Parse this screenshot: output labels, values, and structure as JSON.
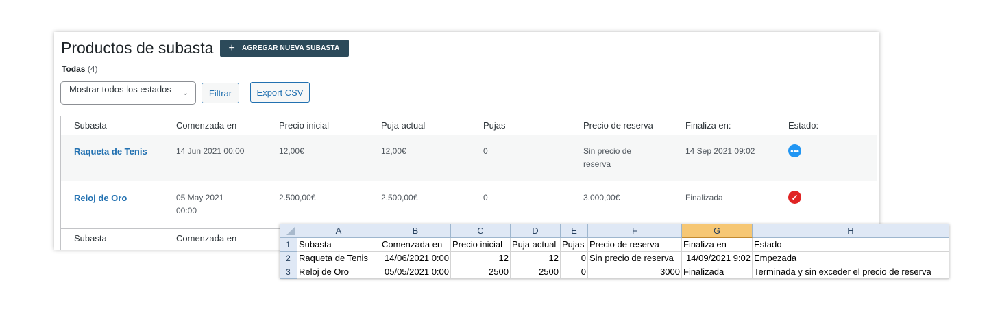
{
  "page": {
    "title": "Productos de subasta",
    "add_button": "AGREGAR NUEVA SUBASTA",
    "filter_label": "Todas",
    "filter_count": "(4)",
    "status_select_value": "Mostrar todos los estados",
    "filter_button": "Filtrar",
    "export_button": "Export CSV"
  },
  "table": {
    "columns": [
      "Subasta",
      "Comenzada en",
      "Precio inicial",
      "Puja actual",
      "Pujas",
      "Precio de reserva",
      "Finaliza en:",
      "Estado:"
    ],
    "rows": [
      {
        "name": "Raqueta de Tenis",
        "started": "14 Jun 2021 00:00",
        "start_price": "12,00€",
        "current_bid": "12,00€",
        "bids": "0",
        "reserve_line1": "Sin precio de",
        "reserve_line2": "reserva",
        "ends": "14 Sep 2021 09:02",
        "status_icon": "more-icon",
        "status_color": "#2196f3"
      },
      {
        "name": "Reloj de Oro",
        "started_line1": "05 May 2021",
        "started_line2": "00:00",
        "start_price": "2.500,00€",
        "current_bid": "2.500,00€",
        "bids": "0",
        "reserve": "3.000,00€",
        "ends": "Finalizada",
        "status_icon": "check-icon",
        "status_color": "#e02424"
      }
    ],
    "footer_columns": [
      "Subasta",
      "Comenzada en"
    ]
  },
  "sheet": {
    "col_headers": [
      "A",
      "B",
      "C",
      "D",
      "E",
      "F",
      "G",
      "H"
    ],
    "row_headers": [
      "1",
      "2",
      "3"
    ],
    "selected_col": "G",
    "header_row": [
      "Subasta",
      "Comenzada en",
      "Precio inicial",
      "Puja actual",
      "Pujas",
      "Precio de reserva",
      "Finaliza en",
      "Estado"
    ],
    "rows": [
      [
        "Raqueta de Tenis",
        "14/06/2021 0:00",
        "12",
        "12",
        "0",
        "Sin precio de reserva",
        "14/09/2021 9:02",
        "Empezada"
      ],
      [
        "Reloj de Oro",
        "05/05/2021 0:00",
        "2500",
        "2500",
        "0",
        "3000",
        "Finalizada",
        "Terminada y sin exceder el precio de reserva"
      ]
    ]
  }
}
